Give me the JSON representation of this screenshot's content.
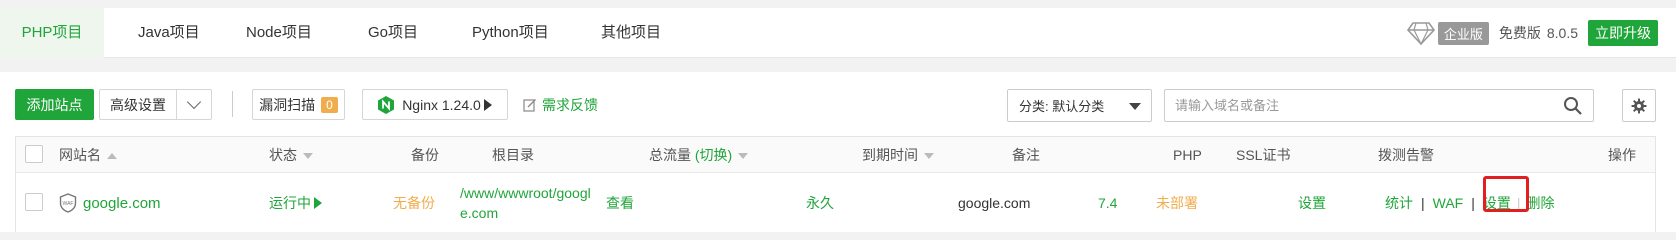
{
  "tabs": [
    {
      "label": "PHP项目",
      "active": true
    },
    {
      "label": "Java项目",
      "active": false
    },
    {
      "label": "Node项目",
      "active": false
    },
    {
      "label": "Go项目",
      "active": false
    },
    {
      "label": "Python项目",
      "active": false
    },
    {
      "label": "其他项目",
      "active": false
    }
  ],
  "edition": {
    "enterprise_badge": "企业版",
    "free_label": "免费版",
    "version": "8.0.5",
    "upgrade_label": "立即升级"
  },
  "toolbar": {
    "add_site_label": "添加站点",
    "advanced_label": "高级设置",
    "vuln_scan_label": "漏洞扫描",
    "vuln_count": "0",
    "nginx_label": "Nginx 1.24.0",
    "feedback_label": "需求反馈",
    "category_select": "分类: 默认分类",
    "search_placeholder": "请输入域名或备注"
  },
  "table": {
    "headers": {
      "site_name": "网站名",
      "status": "状态",
      "backup": "备份",
      "root_dir": "根目录",
      "traffic": "总流量",
      "traffic_toggle": "(切换)",
      "expiry": "到期时间",
      "remark": "备注",
      "php": "PHP",
      "ssl": "SSL证书",
      "monitor": "拨测告警",
      "actions": "操作"
    },
    "rows": [
      {
        "site_name": "google.com",
        "status": "运行中",
        "backup": "无备份",
        "root_dir": "/www/wwwroot/google.com",
        "traffic": "查看",
        "expiry": "永久",
        "remark": "google.com",
        "php": "7.4",
        "ssl": "未部署",
        "monitor": "设置",
        "actions": {
          "stats": "统计",
          "waf": "WAF",
          "settings": "设置",
          "delete": "删除"
        }
      }
    ]
  },
  "colors": {
    "brand_green": "#20a53a",
    "warning_orange": "#f0ad4e",
    "highlight_red": "#e02020"
  },
  "icons": [
    "diamond-icon",
    "chevron-down-icon",
    "nginx-icon",
    "play-icon",
    "edit-icon",
    "caret-down-icon",
    "search-icon",
    "gear-icon",
    "sort-icon",
    "waf-shield-icon"
  ]
}
